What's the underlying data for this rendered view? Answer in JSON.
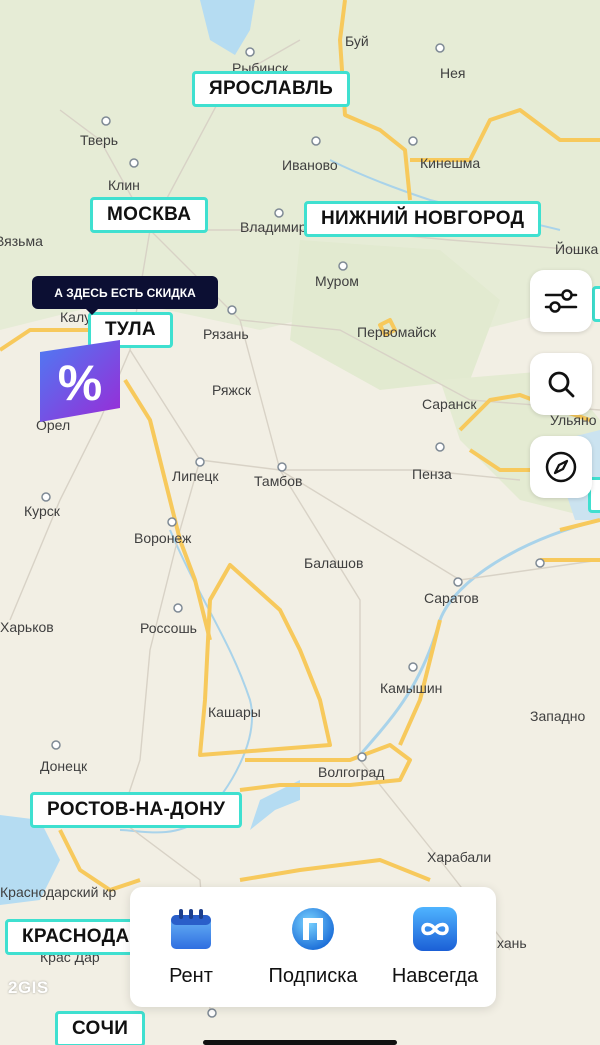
{
  "map": {
    "watermark": "2GIS",
    "place_labels": [
      {
        "id": "rybinsk",
        "text": "Рыбинск"
      },
      {
        "id": "buy",
        "text": "Буй"
      },
      {
        "id": "neya",
        "text": "Нея"
      },
      {
        "id": "tver",
        "text": "Тверь"
      },
      {
        "id": "ivanovo",
        "text": "Иваново"
      },
      {
        "id": "kineshma",
        "text": "Кинешма"
      },
      {
        "id": "klin",
        "text": "Клин"
      },
      {
        "id": "vladimir",
        "text": "Владимир"
      },
      {
        "id": "yoshkar",
        "text": "Йошка"
      },
      {
        "id": "vyazma",
        "text": "Вязьма"
      },
      {
        "id": "murom",
        "text": "Муром"
      },
      {
        "id": "kaluga",
        "text": "Калуга"
      },
      {
        "id": "ryazan",
        "text": "Рязань"
      },
      {
        "id": "pervomaysk",
        "text": "Первомайск"
      },
      {
        "id": "ryazhsk",
        "text": "Ряжск"
      },
      {
        "id": "saransk",
        "text": "Саранск"
      },
      {
        "id": "ulyanovsk",
        "text": "Ульяно"
      },
      {
        "id": "orel",
        "text": "Орел"
      },
      {
        "id": "lipetsk",
        "text": "Липецк"
      },
      {
        "id": "tambov",
        "text": "Тамбов"
      },
      {
        "id": "penza",
        "text": "Пенза"
      },
      {
        "id": "kursk",
        "text": "Курск"
      },
      {
        "id": "voronezh",
        "text": "Воронеж"
      },
      {
        "id": "balashov",
        "text": "Балашов"
      },
      {
        "id": "saratov",
        "text": "Саратов"
      },
      {
        "id": "kharkov",
        "text": "Харьков"
      },
      {
        "id": "rossosh",
        "text": "Россошь"
      },
      {
        "id": "kamyshin",
        "text": "Камышин"
      },
      {
        "id": "zapadnoe",
        "text": "Западно"
      },
      {
        "id": "kashary",
        "text": "Кашары"
      },
      {
        "id": "donetsk",
        "text": "Донецк"
      },
      {
        "id": "volgograd",
        "text": "Волгоград"
      },
      {
        "id": "kharabali",
        "text": "Харабали"
      },
      {
        "id": "krasnodar_kr",
        "text": "Краснодарский кр"
      },
      {
        "id": "astrakhan",
        "text": "хань"
      },
      {
        "id": "krasnodar_town",
        "text": "Крас  Дар"
      }
    ],
    "city_pills": [
      {
        "id": "yaroslavl",
        "text": "ЯРОСЛАВЛЬ"
      },
      {
        "id": "moskva",
        "text": "МОСКВА"
      },
      {
        "id": "nizhny",
        "text": "НИЖНИЙ НОВГОРОД"
      },
      {
        "id": "tula",
        "text": "ТУЛА"
      },
      {
        "id": "rostov",
        "text": "РОСТОВ-НА-ДОНУ"
      },
      {
        "id": "krasnodar",
        "text": "КРАСНОДАР"
      },
      {
        "id": "sochi",
        "text": "СОЧИ"
      }
    ]
  },
  "tooltip": {
    "text": "А ЗДЕСЬ ЕСТЬ СКИДКА"
  },
  "badge": {
    "glyph": "%"
  },
  "controls": [
    {
      "id": "filter",
      "icon": "sliders-icon"
    },
    {
      "id": "search",
      "icon": "search-icon"
    },
    {
      "id": "compass",
      "icon": "compass-icon"
    }
  ],
  "bottom_tabs": [
    {
      "id": "rent",
      "label": "Рент",
      "icon": "calendar-icon"
    },
    {
      "id": "subscription",
      "label": "Подписка",
      "icon": "subscription-p-icon"
    },
    {
      "id": "forever",
      "label": "Навсегда",
      "icon": "infinity-icon"
    }
  ],
  "colors": {
    "pill_border": "#3fe0d0",
    "region_border": "#f7c95c",
    "water": "#b5dcf2",
    "tooltip_bg": "#0c0f33",
    "badge_top": "#5a6cf0",
    "badge_bottom": "#8b2bd8"
  }
}
